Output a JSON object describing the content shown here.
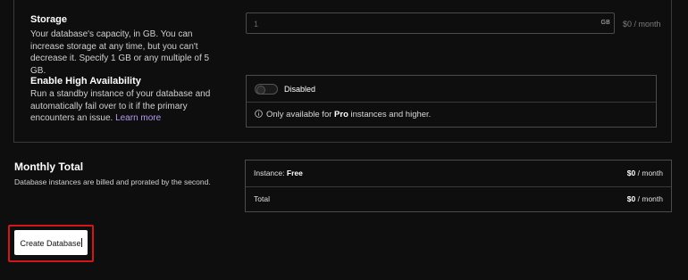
{
  "storage": {
    "title": "Storage",
    "description": "Your database's capacity, in GB. You can increase storage at any time, but you can't decrease it. Specify 1 GB or any multiple of 5 GB.",
    "input_placeholder": "1",
    "unit": "GB",
    "price": "$0 / month"
  },
  "high_availability": {
    "title": "Enable High Availability",
    "description": "Run a standby instance of your database and automatically fail over to it if the primary encounters an issue.",
    "link": "Learn more",
    "toggle_label": "Disabled",
    "toggle_on": false,
    "info_prefix": "Only available for",
    "info_bold": "Pro",
    "info_suffix": "instances and higher."
  },
  "monthly_total": {
    "title": "Monthly Total",
    "description": "Database instances are billed and prorated by the second.",
    "rows": [
      {
        "label": "Instance:",
        "tier": "Free",
        "amount": "$0",
        "period": "/ month"
      },
      {
        "label": "Total",
        "tier": "",
        "amount": "$0",
        "period": "/ month"
      }
    ]
  },
  "actions": {
    "create_label": "Create Database"
  },
  "colors": {
    "highlight": "#d01818",
    "link": "#b49cf5",
    "background": "#0e0e0e"
  }
}
